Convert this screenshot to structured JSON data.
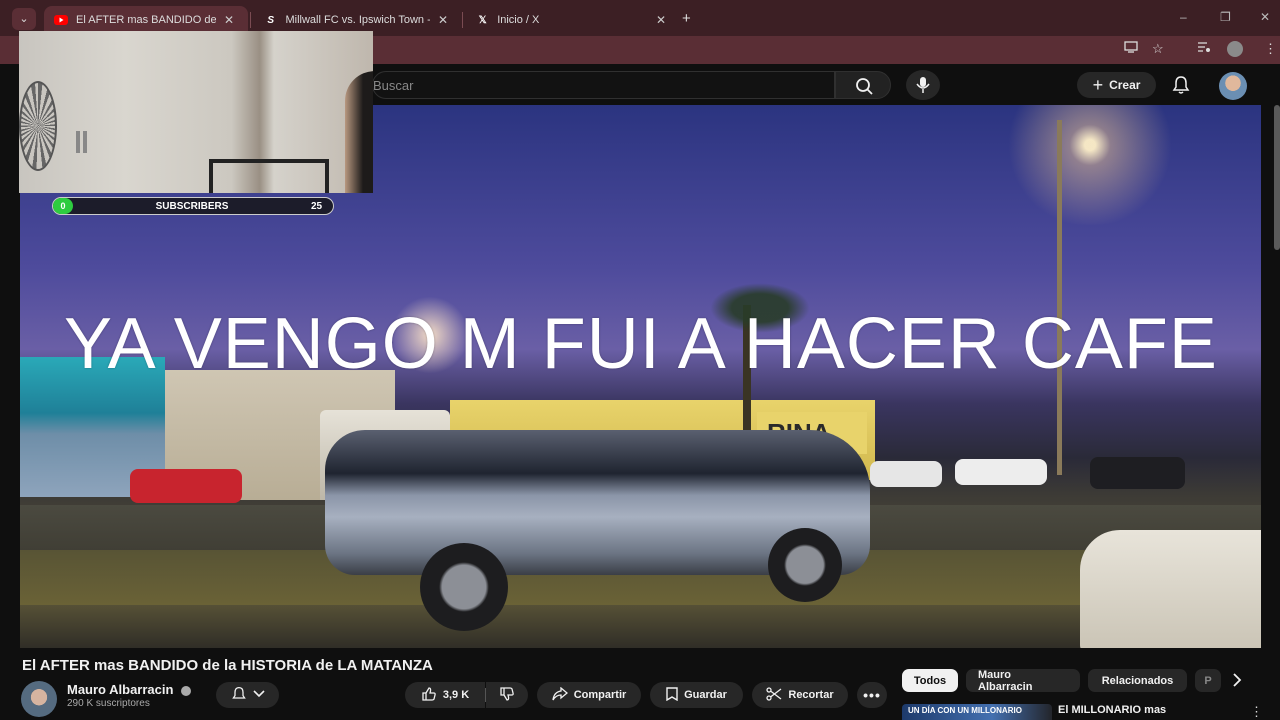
{
  "browser": {
    "tabs": [
      {
        "title": "El AFTER mas BANDIDO de la H",
        "favicon": "youtube-icon",
        "active": true
      },
      {
        "title": "Millwall FC vs. Ipswich Town - S",
        "favicon": "sofascore-icon",
        "active": false
      },
      {
        "title": "Inicio / X",
        "favicon": "x-icon",
        "active": false
      }
    ],
    "new_tab": "+",
    "window_controls": [
      "–",
      "❐",
      "✕"
    ]
  },
  "youtube": {
    "search_placeholder": "Buscar",
    "create_label": "Crear"
  },
  "stream_overlay": {
    "subscribers_label": "SUBSCRIBERS",
    "subscribers_current": "0",
    "subscribers_goal": "25",
    "caption": "YA VENGO M FUI A HACER CAFE"
  },
  "video_scene": {
    "truck_sign": "RINA"
  },
  "video": {
    "title": "El AFTER mas BANDIDO de la HISTORIA de LA MATANZA",
    "channel": "Mauro Albarracin",
    "subscribers": "290 K suscriptores",
    "likes": "3,9 K",
    "share_label": "Compartir",
    "save_label": "Guardar",
    "clip_label": "Recortar"
  },
  "chips": [
    "Todos",
    "Mauro Albarracin",
    "Relacionados",
    "P"
  ],
  "recommended": {
    "first_title": "El MILLONARIO mas",
    "thumb_text": "UN DÍA CON UN MILLONARIO"
  },
  "colors": {
    "tabbar": "#3c1f24",
    "toolbar": "#5a2e35",
    "yt_bg": "#0f0f0f",
    "progress_green": "#2ecc40"
  }
}
